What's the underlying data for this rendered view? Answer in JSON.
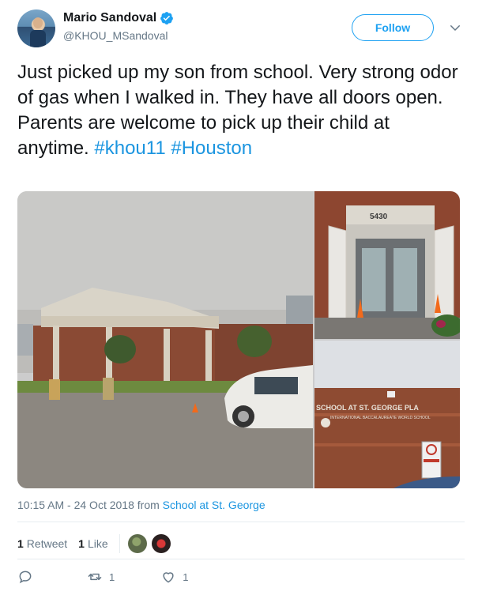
{
  "user": {
    "name": "Mario Sandoval",
    "handle": "@KHOU_MSandoval",
    "verified": true
  },
  "follow_button": {
    "label": "Follow"
  },
  "tweet": {
    "text": "Just picked up my son from school. Very strong odor of gas when I walked in. They have all doors open.   Parents are welcome to pick up their child at anytime.",
    "hashtags": [
      "#khou11",
      "#Houston"
    ]
  },
  "media": {
    "photos": [
      {
        "description_icon": "school-building-photo"
      },
      {
        "door_number": "5430"
      },
      {
        "sign_text": "SCHOOL AT ST. GEORGE PLA",
        "sign_subtext": "INTERNATIONAL BACCALAUREATE WORLD SCHOOL"
      }
    ]
  },
  "meta": {
    "timestamp": "10:15 AM - 24 Oct 2018",
    "from_prefix": "from",
    "source": "School at St. George"
  },
  "stats": {
    "retweets_count": "1",
    "retweets_label": "Retweet",
    "likes_count": "1",
    "likes_label": "Like"
  },
  "actions": {
    "reply_count": "",
    "retweet_count": "1",
    "like_count": "1"
  },
  "colors": {
    "accent": "#1da1f2",
    "link": "#1b95e0",
    "muted": "#657786"
  }
}
